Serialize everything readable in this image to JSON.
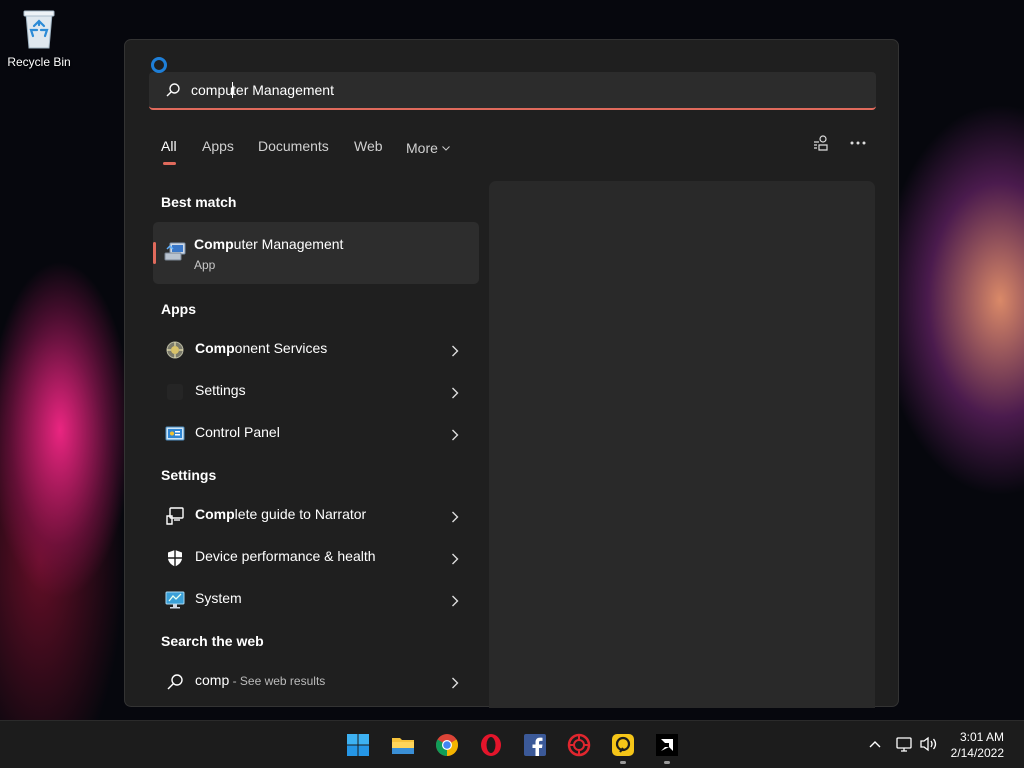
{
  "desktop": {
    "recycle_bin_label": "Recycle Bin"
  },
  "search": {
    "typed_bold": "comp",
    "typed_rest_1": "u",
    "typed_rest_2": "ter Management"
  },
  "tabs": [
    {
      "label": "All"
    },
    {
      "label": "Apps"
    },
    {
      "label": "Documents"
    },
    {
      "label": "Web"
    },
    {
      "label": "More"
    }
  ],
  "best_match": {
    "heading": "Best match",
    "title_bold": "Comp",
    "title_rest": "uter Management",
    "subtitle": "App"
  },
  "apps": {
    "heading": "Apps",
    "items": [
      {
        "bold": "Comp",
        "rest": "onent Services",
        "icon": "component-services-icon"
      },
      {
        "bold": "",
        "rest": "Settings",
        "icon": "settings-icon"
      },
      {
        "bold": "",
        "rest": "Control Panel",
        "icon": "control-panel-icon"
      }
    ]
  },
  "settings": {
    "heading": "Settings",
    "items": [
      {
        "bold": "Comp",
        "rest": "lete guide to Narrator",
        "icon": "narrator-icon"
      },
      {
        "bold": "",
        "rest": "Device performance & health",
        "icon": "shield-icon"
      },
      {
        "bold": "",
        "rest": "System",
        "icon": "system-monitor-icon"
      }
    ]
  },
  "web": {
    "heading": "Search the web",
    "query": "comp",
    "suffix": " - See web results"
  },
  "taskbar": {
    "apps": [
      "windows-start-icon",
      "file-explorer-icon",
      "chrome-icon",
      "opera-icon",
      "facebook-icon",
      "antivirus-icon",
      "app-yellow-icon",
      "amd-icon"
    ],
    "time": "3:01 AM",
    "date": "2/14/2022"
  },
  "colors": {
    "accent": "#e06a5c",
    "panel": "#1f1f1f",
    "preview": "#292929",
    "taskbar": "#1c1c1c"
  }
}
